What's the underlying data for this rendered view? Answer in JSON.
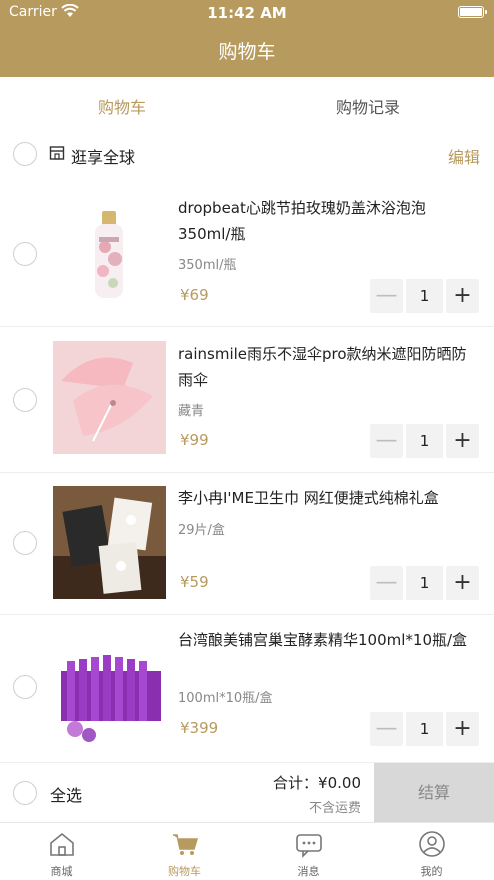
{
  "status_bar": {
    "carrier": "Carrier",
    "time": "11:42 AM"
  },
  "header": {
    "title": "购物车"
  },
  "tabs": [
    {
      "label": "购物车"
    },
    {
      "label": "购物记录"
    }
  ],
  "shop": {
    "name": "逛享全球",
    "edit_label": "编辑",
    "icon": "store-icon"
  },
  "items": [
    {
      "name": "dropbeat心跳节拍玫瑰奶盖沐浴泡泡350ml/瓶",
      "spec": "350ml/瓶",
      "price": "¥69",
      "qty": "1"
    },
    {
      "name": "rainsmile雨乐不湿伞pro款纳米遮阳防晒防雨伞",
      "spec": "藏青",
      "price": "¥99",
      "qty": "1"
    },
    {
      "name": "李小冉I'ME卫生巾 网红便捷式纯棉礼盒",
      "spec": "29片/盒",
      "price": "¥59",
      "qty": "1"
    },
    {
      "name": "台湾酿美铺宫巢宝酵素精华100ml*10瓶/盒",
      "spec": "100ml*10瓶/盒",
      "price": "¥399",
      "qty": "1"
    }
  ],
  "stepper": {
    "minus": "—",
    "plus": "+"
  },
  "footer": {
    "select_all": "全选",
    "total": "合计：¥0.00",
    "shipping_note": "不含运费",
    "checkout": "结算"
  },
  "tabbar": [
    {
      "label": "商城",
      "icon": "home-icon"
    },
    {
      "label": "购物车",
      "icon": "cart-icon"
    },
    {
      "label": "消息",
      "icon": "message-icon"
    },
    {
      "label": "我的",
      "icon": "user-icon"
    }
  ],
  "colors": {
    "accent": "#b79a5e",
    "checkout_bg": "#d8d8d8"
  }
}
